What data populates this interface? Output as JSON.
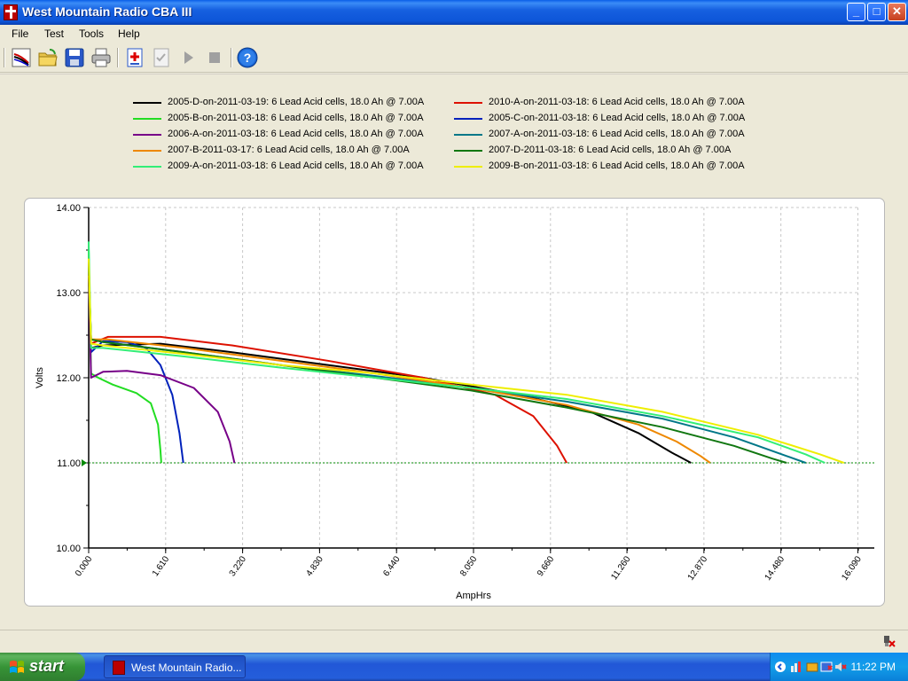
{
  "window": {
    "title": "West Mountain Radio CBA III"
  },
  "title_buttons": {
    "minimize": "_",
    "maximize": "□",
    "close": "✕"
  },
  "menu": {
    "items": [
      "File",
      "Test",
      "Tools",
      "Help"
    ]
  },
  "toolbar": {
    "icons": [
      "new-test-icon",
      "open-folder-icon",
      "save-icon",
      "print-icon",
      "add-battery-icon",
      "checklist-icon",
      "play-icon",
      "stop-icon",
      "help-icon"
    ]
  },
  "colors": {
    "black": "#000000",
    "red": "#dd1100",
    "green": "#22dd22",
    "blue": "#0022bb",
    "purple": "#770088",
    "teal": "#007788",
    "orange": "#ee8800",
    "darkgreen": "#117711",
    "springgreen": "#33ee77",
    "yellow": "#eeee00",
    "cutoff": "#008800"
  },
  "legend": [
    {
      "label": "2005-D-on-2011-03-19: 6 Lead Acid cells, 18.0 Ah @ 7.00A",
      "color": "#000000"
    },
    {
      "label": "2010-A-on-2011-03-18: 6 Lead Acid cells, 18.0 Ah @ 7.00A",
      "color": "#dd1100"
    },
    {
      "label": "2005-B-on-2011-03-18: 6 Lead Acid cells, 18.0 Ah @ 7.00A",
      "color": "#22dd22"
    },
    {
      "label": "2005-C-on-2011-03-18: 6 Lead Acid cells, 18.0 Ah @ 7.00A",
      "color": "#0022bb"
    },
    {
      "label": "2006-A-on-2011-03-18: 6 Lead Acid cells, 18.0 Ah @ 7.00A",
      "color": "#770088"
    },
    {
      "label": "2007-A-on-2011-03-18: 6 Lead Acid cells, 18.0 Ah @ 7.00A",
      "color": "#007788"
    },
    {
      "label": "2007-B-2011-03-17: 6 Lead Acid cells, 18.0 Ah @ 7.00A",
      "color": "#ee8800"
    },
    {
      "label": "2007-D-2011-03-18: 6 Lead Acid cells, 18.0 Ah @ 7.00A",
      "color": "#117711"
    },
    {
      "label": "2009-A-on-2011-03-18: 6 Lead Acid cells, 18.0 Ah @ 7.00A",
      "color": "#33ee77"
    },
    {
      "label": "2009-B-on-2011-03-18: 6 Lead Acid cells, 18.0 Ah @ 7.00A",
      "color": "#eeee00"
    }
  ],
  "chart_data": {
    "type": "line",
    "title": "",
    "xlabel": "AmpHrs",
    "ylabel": "Volts",
    "xlim": [
      0,
      16.1
    ],
    "ylim": [
      10.0,
      14.0
    ],
    "x_ticks": [
      "0.000",
      "1.610",
      "3.220",
      "4.830",
      "6.440",
      "8.050",
      "9.660",
      "11.260",
      "12.870",
      "14.480",
      "16.090"
    ],
    "y_ticks": [
      "10.00",
      "11.00",
      "12.00",
      "13.00",
      "14.00"
    ],
    "grid": true,
    "cutoff_voltage": 11.0,
    "series": [
      {
        "name": "2005-D-on-2011-03-19",
        "color": "#000000",
        "x": [
          0,
          0.05,
          0.3,
          1.5,
          3,
          5,
          7,
          9,
          10.5,
          11.5,
          12.2,
          12.6
        ],
        "y": [
          13.4,
          12.35,
          12.38,
          12.4,
          12.3,
          12.15,
          12.0,
          11.8,
          11.6,
          11.35,
          11.12,
          11.0
        ]
      },
      {
        "name": "2010-A-on-2011-03-18",
        "color": "#dd1100",
        "x": [
          0,
          0.05,
          0.4,
          1.5,
          3,
          5,
          7,
          8.5,
          9.3,
          9.8,
          10.0
        ],
        "y": [
          13.2,
          12.4,
          12.48,
          12.48,
          12.38,
          12.2,
          12.0,
          11.8,
          11.55,
          11.2,
          11.0
        ]
      },
      {
        "name": "2005-B-on-2011-03-18",
        "color": "#22dd22",
        "x": [
          0,
          0.05,
          0.2,
          0.5,
          1.0,
          1.3,
          1.45,
          1.5,
          1.52
        ],
        "y": [
          13.5,
          12.05,
          12.0,
          11.92,
          11.82,
          11.7,
          11.45,
          11.15,
          11.0
        ]
      },
      {
        "name": "2005-C-on-2011-03-18",
        "color": "#0022bb",
        "x": [
          0,
          0.05,
          0.3,
          0.8,
          1.2,
          1.5,
          1.75,
          1.9,
          1.98
        ],
        "y": [
          13.2,
          12.3,
          12.43,
          12.42,
          12.35,
          12.15,
          11.8,
          11.35,
          11.0
        ]
      },
      {
        "name": "2006-A-on-2011-03-18",
        "color": "#770088",
        "x": [
          0,
          0.05,
          0.3,
          0.8,
          1.5,
          2.2,
          2.7,
          2.95,
          3.05
        ],
        "y": [
          13.3,
          12.0,
          12.07,
          12.08,
          12.03,
          11.88,
          11.6,
          11.25,
          11.0
        ]
      },
      {
        "name": "2007-A-on-2011-03-18",
        "color": "#007788",
        "x": [
          0,
          0.05,
          0.3,
          2,
          4,
          6,
          8,
          10,
          12,
          13.5,
          14.6,
          15.0
        ],
        "y": [
          13.3,
          12.45,
          12.42,
          12.3,
          12.15,
          12.02,
          11.88,
          11.72,
          11.52,
          11.3,
          11.08,
          11.0
        ]
      },
      {
        "name": "2007-B-2011-03-17",
        "color": "#ee8800",
        "x": [
          0,
          0.05,
          0.4,
          2,
          4,
          6,
          8,
          10,
          11.5,
          12.3,
          12.8,
          13.0
        ],
        "y": [
          13.2,
          12.45,
          12.45,
          12.35,
          12.2,
          12.05,
          11.88,
          11.68,
          11.45,
          11.25,
          11.08,
          11.0
        ]
      },
      {
        "name": "2007-D-2011-03-18",
        "color": "#117711",
        "x": [
          0,
          0.05,
          0.3,
          2,
          4,
          6,
          8,
          10,
          12,
          13.5,
          14.3,
          14.6
        ],
        "y": [
          13.3,
          12.45,
          12.42,
          12.3,
          12.15,
          12.0,
          11.85,
          11.65,
          11.42,
          11.2,
          11.05,
          11.0
        ]
      },
      {
        "name": "2009-A-on-2011-03-18",
        "color": "#33ee77",
        "x": [
          0,
          0.05,
          0.3,
          2,
          4,
          6,
          8,
          10,
          12,
          14,
          15.0,
          15.4
        ],
        "y": [
          13.6,
          12.35,
          12.35,
          12.25,
          12.12,
          12.0,
          11.88,
          11.75,
          11.55,
          11.3,
          11.1,
          11.0
        ]
      },
      {
        "name": "2009-B-on-2011-03-18",
        "color": "#eeee00",
        "x": [
          0,
          0.05,
          0.3,
          2,
          4,
          6,
          8,
          10,
          12,
          14,
          15.3,
          15.8
        ],
        "y": [
          13.4,
          12.4,
          12.38,
          12.28,
          12.15,
          12.05,
          11.92,
          11.8,
          11.6,
          11.33,
          11.1,
          11.0
        ]
      }
    ]
  },
  "taskbar": {
    "start_label": "start",
    "task_label": "West Mountain Radio...",
    "clock": "11:22 PM"
  }
}
